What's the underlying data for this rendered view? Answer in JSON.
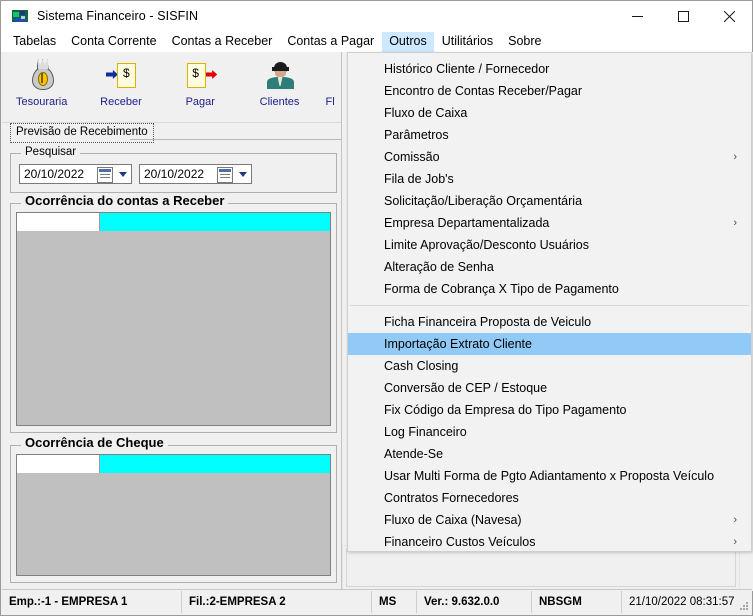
{
  "window": {
    "title": "Sistema Financeiro - SISFIN",
    "icon": "app-icon",
    "controls": {
      "minimize": "—",
      "maximize": "☐",
      "close": "✕"
    }
  },
  "menubar": {
    "items": [
      {
        "label": "Tabelas",
        "open": false
      },
      {
        "label": "Conta Corrente",
        "open": false
      },
      {
        "label": "Contas a Receber",
        "open": false
      },
      {
        "label": "Contas a Pagar",
        "open": false
      },
      {
        "label": "Outros",
        "open": true
      },
      {
        "label": "Utilitários",
        "open": false
      },
      {
        "label": "Sobre",
        "open": false
      }
    ]
  },
  "toolbar": {
    "items": [
      {
        "label": "Tesouraria",
        "icon": "money-bag-icon"
      },
      {
        "label": "Receber",
        "icon": "receive-document-icon"
      },
      {
        "label": "Pagar",
        "icon": "pay-document-icon"
      },
      {
        "label": "Clientes",
        "icon": "client-person-icon"
      },
      {
        "label": "Fl",
        "icon": "cashflow-icon"
      }
    ]
  },
  "tabs": [
    {
      "label": "Previsão de Recebimento",
      "active": true
    }
  ],
  "form": {
    "search_group_label": "Pesquisar",
    "date_from": "20/10/2022",
    "date_to": "20/10/2022",
    "date_icon": "calendar-icon",
    "dropdown_icon": "chevron-down-icon",
    "groups": [
      {
        "label": "Ocorrência do contas a Receber"
      },
      {
        "label": "Ocorrência de Cheque"
      }
    ]
  },
  "dropdown": {
    "title": "Outros",
    "items": [
      {
        "label": "Histórico Cliente / Fornecedor",
        "submenu": false,
        "selected": false,
        "separator_before": false
      },
      {
        "label": "Encontro de Contas Receber/Pagar",
        "submenu": false,
        "selected": false,
        "separator_before": false
      },
      {
        "label": "Fluxo de Caixa",
        "submenu": false,
        "selected": false,
        "separator_before": false
      },
      {
        "label": "Parâmetros",
        "submenu": false,
        "selected": false,
        "separator_before": false
      },
      {
        "label": "Comissão",
        "submenu": true,
        "selected": false,
        "separator_before": false
      },
      {
        "label": "Fila de Job's",
        "submenu": false,
        "selected": false,
        "separator_before": false
      },
      {
        "label": "Solicitação/Liberação Orçamentária",
        "submenu": false,
        "selected": false,
        "separator_before": false
      },
      {
        "label": "Empresa Departamentalizada",
        "submenu": true,
        "selected": false,
        "separator_before": false
      },
      {
        "label": "Limite Aprovação/Desconto Usuários",
        "submenu": false,
        "selected": false,
        "separator_before": false
      },
      {
        "label": "Alteração de Senha",
        "submenu": false,
        "selected": false,
        "separator_before": false
      },
      {
        "label": "Forma de Cobrança X Tipo de Pagamento",
        "submenu": false,
        "selected": false,
        "separator_before": false
      },
      {
        "label": "Ficha Financeira Proposta de Veiculo",
        "submenu": false,
        "selected": false,
        "separator_before": true
      },
      {
        "label": "Importação Extrato Cliente",
        "submenu": false,
        "selected": true,
        "separator_before": false
      },
      {
        "label": "Cash Closing",
        "submenu": false,
        "selected": false,
        "separator_before": false
      },
      {
        "label": "Conversão de CEP / Estoque",
        "submenu": false,
        "selected": false,
        "separator_before": false
      },
      {
        "label": "Fix  Código da Empresa do Tipo Pagamento",
        "submenu": false,
        "selected": false,
        "separator_before": false
      },
      {
        "label": "Log Financeiro",
        "submenu": false,
        "selected": false,
        "separator_before": false
      },
      {
        "label": "Atende-Se",
        "submenu": false,
        "selected": false,
        "separator_before": false
      },
      {
        "label": "Usar Multi Forma de Pgto  Adiantamento x Proposta Veículo",
        "submenu": false,
        "selected": false,
        "separator_before": false
      },
      {
        "label": "Contratos Fornecedores",
        "submenu": false,
        "selected": false,
        "separator_before": false
      },
      {
        "label": "Fluxo de Caixa (Navesa)",
        "submenu": true,
        "selected": false,
        "separator_before": false
      },
      {
        "label": "Financeiro Custos Veículos",
        "submenu": true,
        "selected": false,
        "separator_before": false
      }
    ],
    "submenu_glyph": "›"
  },
  "statusbar": {
    "company": "Emp.:-1 - EMPRESA 1",
    "branch": "Fil.:2-EMPRESA 2",
    "db": "MS",
    "version": "Ver.: 9.632.0.0",
    "system": "NBSGM",
    "datetime": "21/10/2022 08:31:57"
  },
  "colors": {
    "menu_highlight": "#91c9f7",
    "menubar_open": "#cde8ff",
    "grid_header": "#00ffff",
    "toolbar_label": "#20208c",
    "window_bg": "#f0f0f0"
  }
}
